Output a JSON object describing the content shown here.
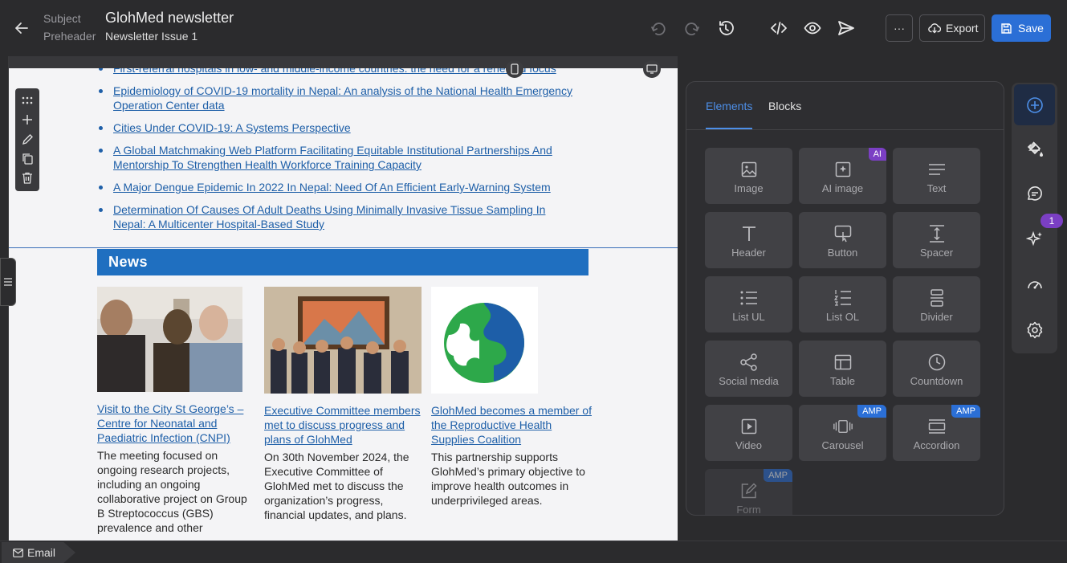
{
  "header": {
    "subject_label": "Subject",
    "subject_value": "GlohMed newsletter",
    "preheader_label": "Preheader",
    "preheader_value": "Newsletter Issue 1",
    "more_label": "···",
    "export_label": "Export",
    "save_label": "Save"
  },
  "content": {
    "publications": [
      "First-referral hospitals in low- and middle-income countries: the need for a renewed focus",
      "Epidemiology of COVID-19 mortality in Nepal: An analysis of the National Health Emergency Operation Center data",
      "Cities Under COVID-19: A Systems Perspective",
      "A Global Matchmaking Web Platform Facilitating Equitable Institutional Partnerships And Mentorship To Strengthen Health Workforce Training Capacity",
      "A Major Dengue Epidemic In 2022 In Nepal: Need Of An Efficient Early-Warning System",
      "Determination Of Causes Of Adult Deaths Using Minimally Invasive Tissue Sampling In Nepal: A Multicenter Hospital-Based Study"
    ],
    "news_heading": "News",
    "news": [
      {
        "title": "Visit to the City St George’s – Centre for Neonatal and Paediatric Infection (CNPI)",
        "text": "The meeting focused on ongoing research projects, including an ongoing collaborative project on Group B Streptococcus (GBS) prevalence and other"
      },
      {
        "title": "Executive Committee members met to discuss progress and plans of GlohMed",
        "text": "On 30th November 2024, the Executive Committee of GlohMed met to discuss the organization’s progress, financial updates, and plans."
      },
      {
        "title": "GlohMed becomes a member of the Reproductive Health Supplies Coalition",
        "text": "This partnership supports GlohMed’s primary objective to improve health outcomes in underprivileged areas."
      }
    ]
  },
  "panel": {
    "tabs": [
      "Elements",
      "Blocks"
    ],
    "elements": [
      {
        "label": "Image",
        "icon": "image-icon",
        "badge": ""
      },
      {
        "label": "AI image",
        "icon": "ai-image-icon",
        "badge": "AI"
      },
      {
        "label": "Text",
        "icon": "text-icon",
        "badge": ""
      },
      {
        "label": "Header",
        "icon": "header-icon",
        "badge": ""
      },
      {
        "label": "Button",
        "icon": "button-icon",
        "badge": ""
      },
      {
        "label": "Spacer",
        "icon": "spacer-icon",
        "badge": ""
      },
      {
        "label": "List UL",
        "icon": "list-ul-icon",
        "badge": ""
      },
      {
        "label": "List OL",
        "icon": "list-ol-icon",
        "badge": ""
      },
      {
        "label": "Divider",
        "icon": "divider-icon",
        "badge": ""
      },
      {
        "label": "Social media",
        "icon": "share-icon",
        "badge": ""
      },
      {
        "label": "Table",
        "icon": "table-icon",
        "badge": ""
      },
      {
        "label": "Countdown",
        "icon": "clock-icon",
        "badge": ""
      },
      {
        "label": "Video",
        "icon": "video-icon",
        "badge": ""
      },
      {
        "label": "Carousel",
        "icon": "carousel-icon",
        "badge": "AMP"
      },
      {
        "label": "Accordion",
        "icon": "accordion-icon",
        "badge": "AMP"
      },
      {
        "label": "Form",
        "icon": "form-icon",
        "badge": "AMP"
      }
    ]
  },
  "rail": {
    "ai_badge_count": "1"
  },
  "footer": {
    "crumb": "Email"
  },
  "colors": {
    "accent": "#2b6fd6",
    "news_bar": "#1f6fc0",
    "link": "#1e5fa8",
    "ai_badge": "#7b3fc4"
  }
}
